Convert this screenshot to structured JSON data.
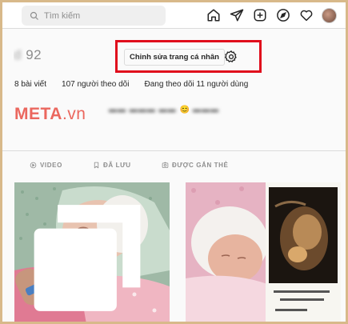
{
  "nav": {
    "search_placeholder": "Tìm kiếm",
    "icons": [
      "home-icon",
      "direct-message-icon",
      "new-post-icon",
      "explore-icon",
      "activity-icon",
      "profile-avatar"
    ]
  },
  "profile": {
    "username_hidden": "d          ",
    "username_visible": "92",
    "edit_button": "Chỉnh sửa trang cá nhân",
    "stats": {
      "posts": "8 bài viết",
      "followers": "107 người theo dõi",
      "following": "Đang theo dõi 11 người dùng"
    },
    "bio_emoji": "😊"
  },
  "watermark": {
    "text": "META",
    "dot": ".vn"
  },
  "tabs": [
    {
      "label": "VIDEO",
      "icon": "video-icon"
    },
    {
      "label": "ĐÃ LƯU",
      "icon": "bookmark-icon"
    },
    {
      "label": "ĐƯỢC GẮN THẺ",
      "icon": "tag-icon"
    }
  ],
  "colors": {
    "highlight": "#e00d1c",
    "watermark": "#e8473c",
    "frame": "#d8b98a"
  },
  "posts": [
    {
      "subject": "newborn-baby-photo",
      "multi": true
    },
    {
      "subject": "newborn-baby-with-ultrasound-photo",
      "multi": false
    }
  ]
}
